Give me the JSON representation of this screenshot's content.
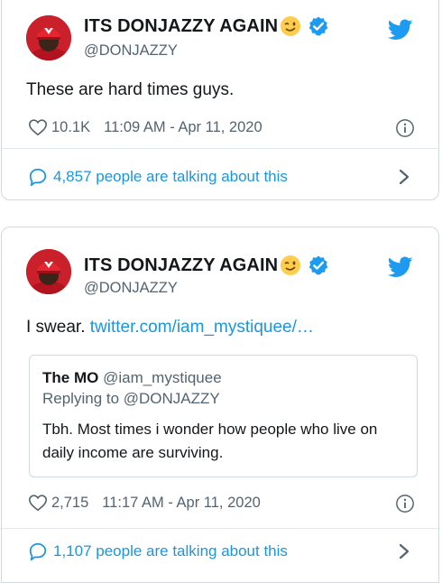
{
  "colors": {
    "accent": "#1b95e0",
    "muted": "#536471",
    "text": "#14171a",
    "border": "#cfd9de"
  },
  "tweets": [
    {
      "name": "ITS DONJAZZY AGAIN",
      "handle": "@DONJAZZY",
      "text": "These are hard times guys.",
      "link": "",
      "likes": "10.1K",
      "timestamp": "11:09 AM - Apr 11, 2020",
      "talking": "4,857 people are talking about this",
      "icons": [
        "avatar",
        "winking-emoji-icon",
        "verified-badge-icon",
        "twitter-bird-icon",
        "heart-icon",
        "info-icon",
        "speech-bubble-icon",
        "chevron-right-icon"
      ]
    },
    {
      "name": "ITS DONJAZZY AGAIN",
      "handle": "@DONJAZZY",
      "text": "I swear. ",
      "link": "twitter.com/iam_mystiquee/…",
      "likes": "2,715",
      "timestamp": "11:17 AM - Apr 11, 2020",
      "talking": "1,107 people are talking about this",
      "quote": {
        "name": "The MO",
        "handle": "@iam_mystiquee",
        "replying": "Replying to @DONJAZZY",
        "text": "Tbh. Most times i wonder how people who live on daily income are surviving."
      }
    }
  ]
}
